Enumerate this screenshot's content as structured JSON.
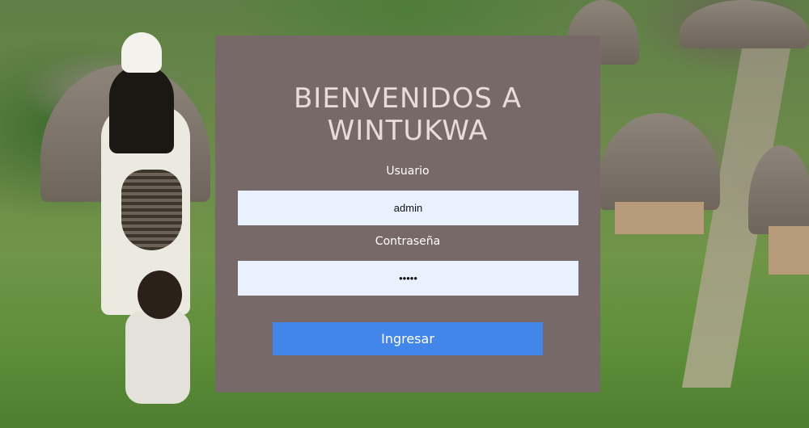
{
  "login": {
    "title_line1": "BIENVENIDOS A",
    "title_line2": "WINTUKWA",
    "username_label": "Usuario",
    "username_value": "admin",
    "password_label": "Contraseña",
    "password_value": "•••••",
    "submit_label": "Ingresar"
  },
  "colors": {
    "panel_bg": "#786969",
    "input_bg": "#e9f0fe",
    "button_bg": "#4286ea",
    "title_text": "#e7dcdc"
  }
}
